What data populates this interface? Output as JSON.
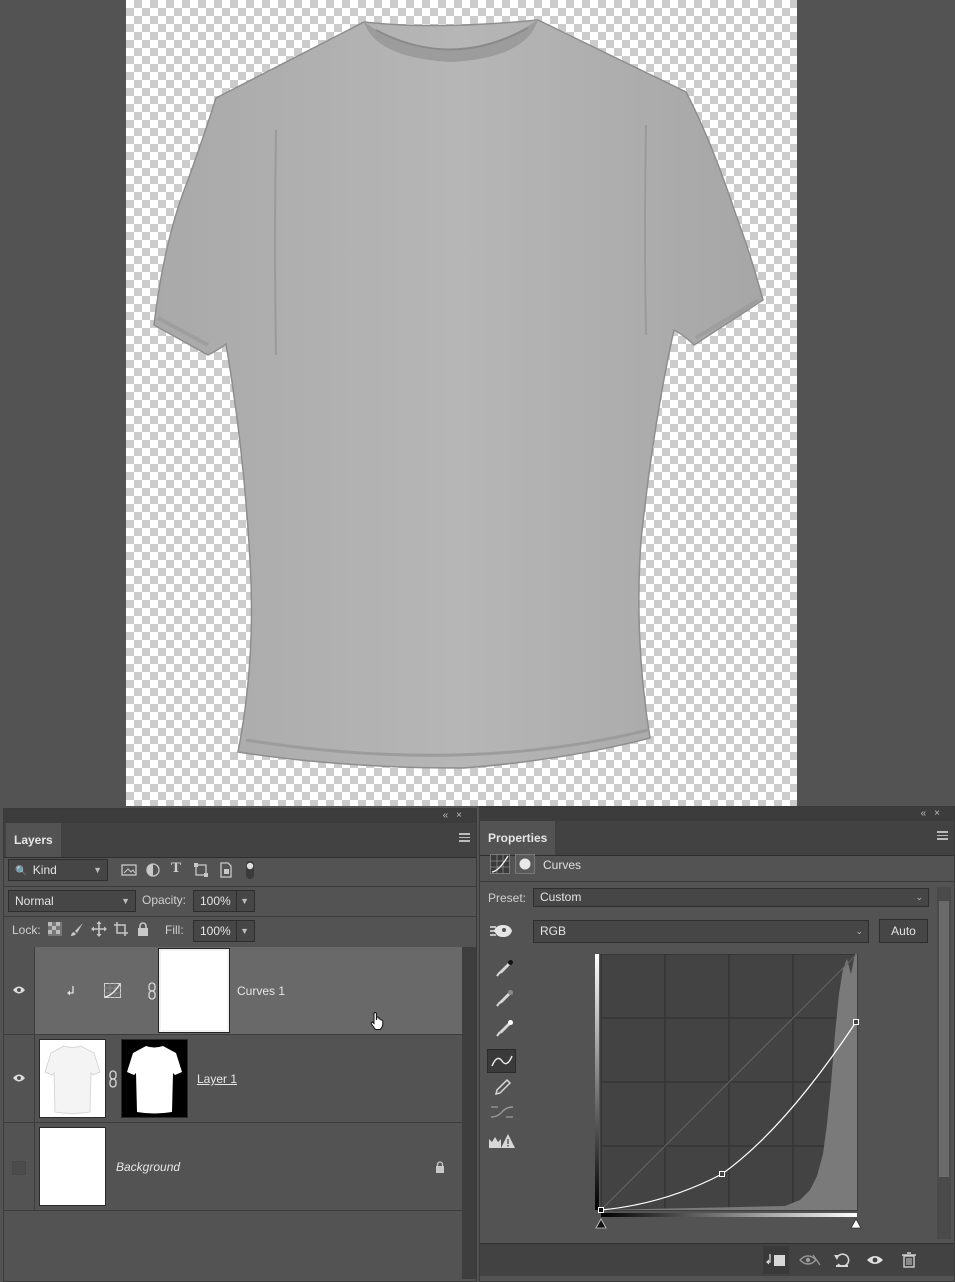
{
  "layers_panel": {
    "tab_label": "Layers",
    "filter": {
      "label": "Kind"
    },
    "blend_mode": "Normal",
    "opacity": {
      "label": "Opacity:",
      "value": "100%"
    },
    "lock": {
      "label": "Lock:"
    },
    "fill": {
      "label": "Fill:",
      "value": "100%"
    },
    "layers": [
      {
        "name": "Curves 1",
        "visible": true,
        "selected": true
      },
      {
        "name": "Layer 1",
        "visible": true,
        "selected": false
      },
      {
        "name": "Background",
        "visible": false,
        "selected": false,
        "locked": true
      }
    ]
  },
  "properties_panel": {
    "tab_label": "Properties",
    "adjustment_title": "Curves",
    "preset": {
      "label": "Preset:",
      "value": "Custom"
    },
    "channel": "RGB",
    "auto_label": "Auto"
  },
  "colors": {
    "workspace": "#535353",
    "panel_dark": "#424242",
    "selected_row": "#696969",
    "shirt": "#b4b4b4"
  }
}
